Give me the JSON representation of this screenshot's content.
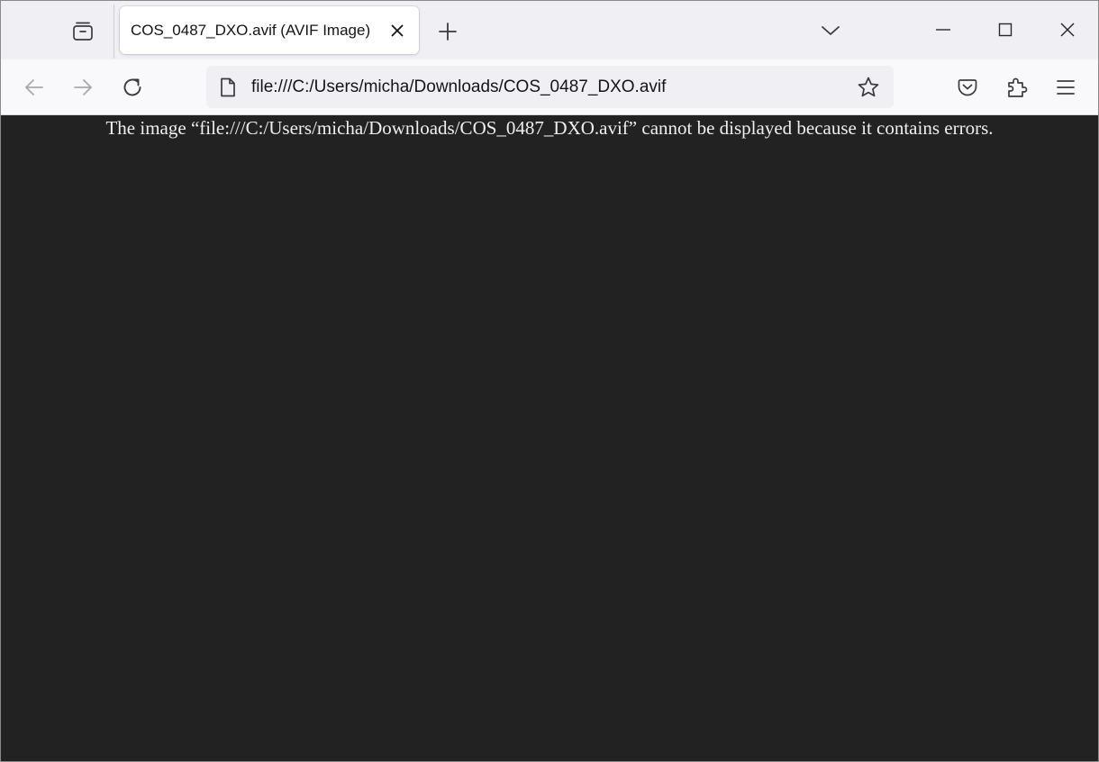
{
  "tab": {
    "title": "COS_0487_DXO.avif (AVIF Image)"
  },
  "urlbar": {
    "url": "file:///C:/Users/micha/Downloads/COS_0487_DXO.avif"
  },
  "content": {
    "error_message": "The image “file:///C:/Users/micha/Downloads/COS_0487_DXO.avif” cannot be displayed because it contains errors."
  },
  "icons": {
    "sidebar_tabs": "tab-sidebar-icon",
    "tab_close": "close-icon",
    "new_tab": "plus-icon",
    "list_tabs": "chevron-down-icon",
    "minimize": "minimize-icon",
    "maximize": "maximize-icon",
    "close_window": "close-icon",
    "back": "arrow-left-icon",
    "forward": "arrow-right-icon",
    "reload": "reload-icon",
    "page": "page-icon",
    "bookmark": "star-icon",
    "pocket": "pocket-icon",
    "extensions": "puzzle-icon",
    "menu": "hamburger-icon"
  },
  "colors": {
    "content_background": "#222222",
    "content_text": "#eeeeee",
    "chrome_background": "#f0f0f4",
    "toolbar_background": "#f9f9fb"
  }
}
